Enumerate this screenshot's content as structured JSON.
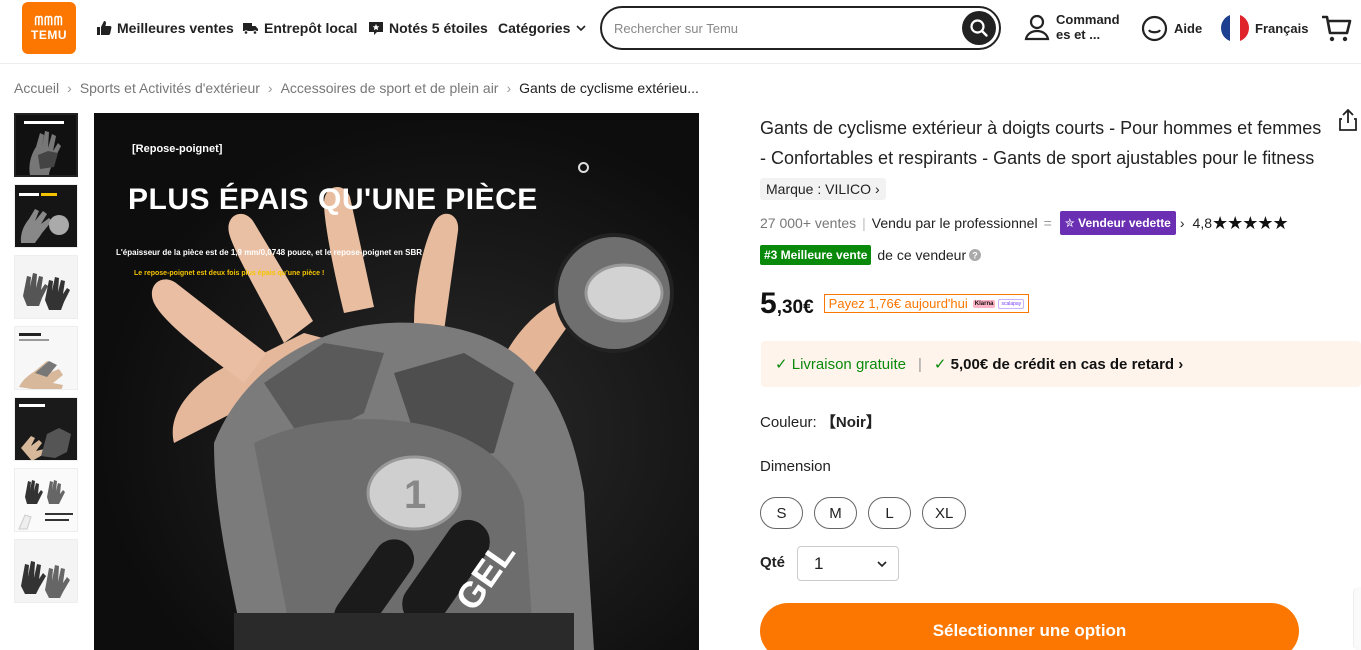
{
  "header": {
    "logo_line1": "ᗰᗰᗰ",
    "logo_line2": "TEMU",
    "nav": [
      {
        "label": "Meilleures ventes",
        "icon": "thumbs-up-icon"
      },
      {
        "label": "Entrepôt local",
        "icon": "truck-icon"
      },
      {
        "label": "Notés 5 étoiles",
        "icon": "star-chat-icon"
      },
      {
        "label": "Catégories",
        "icon": "chevron-down-icon"
      }
    ],
    "search": {
      "placeholder": "Rechercher sur Temu",
      "icon": "search-icon"
    },
    "orders_label": "Command es et ...",
    "help_label": "Aide",
    "language_label": "Français",
    "cart_icon": "cart-icon"
  },
  "breadcrumb": [
    "Accueil",
    "Sports et Activités d'extérieur",
    "Accessoires de sport et de plein air",
    "Gants de cyclisme extérieu..."
  ],
  "gallery": {
    "main_image": {
      "tag": "[Repose-poignet]",
      "title": "PLUS ÉPAIS QU'UNE PIÈCE",
      "line1": "L'épaisseur de la pièce est de 1,9 mm/0,0748 pouce, et le repose-poignet en SBR",
      "line2": "Le repose-poignet est deux fois plus épais qu'une pièce !",
      "gel_text": "GEL",
      "coin_text": "1"
    },
    "thumbnail_count": 7
  },
  "product": {
    "title": "Gants de cyclisme extérieur à doigts courts - Pour hommes et femmes - Confortables et respirants - Gants de sport ajustables pour le fitness",
    "brand": "Marque : VILICO",
    "sales": "27 000+ ventes",
    "sold_by": "Vendu par le professionnel",
    "seller_badge": "Vendeur vedette",
    "rating": "4,8",
    "stars": "★★★★★",
    "rank_badge": "#3 Meilleure vente",
    "rank_suffix": "de ce vendeur",
    "price_main": "5",
    "price_rest": ",30€",
    "pay_today": "Payez 1,76€ aujourd'hui",
    "klarna": "Klarna",
    "scalapay": "scalapay",
    "shipping_free": "Livraison gratuite",
    "late_credit": "5,00€ de crédit en cas de retard",
    "color_label": "Couleur:",
    "color_value": "【Noir】",
    "size_label": "Dimension",
    "sizes": [
      "S",
      "M",
      "L",
      "XL"
    ],
    "qty_label": "Qté",
    "qty_value": "1",
    "cta_label": "Sélectionner une option"
  },
  "colors": {
    "accent": "#fb7701",
    "green": "#0a8a0a",
    "vedette": "#6b2fb3"
  }
}
